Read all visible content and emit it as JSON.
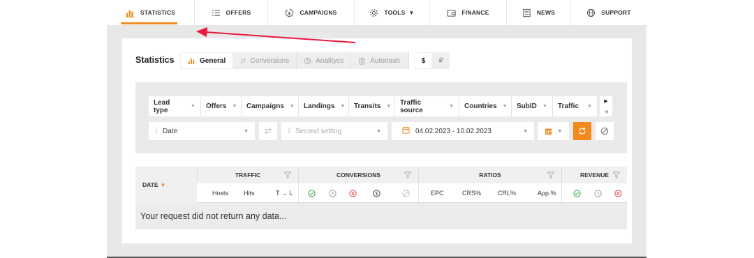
{
  "nav": {
    "items": [
      {
        "label": "STATISTICS",
        "icon": "bar-chart-icon",
        "active": true
      },
      {
        "label": "OFFERS",
        "icon": "list-icon"
      },
      {
        "label": "CAMPAIGNS",
        "icon": "dollar-cycle-icon"
      },
      {
        "label": "TOOLS",
        "icon": "gear-icon"
      },
      {
        "label": "FINANCE",
        "icon": "wallet-icon"
      },
      {
        "label": "NEWS",
        "icon": "newspaper-icon"
      },
      {
        "label": "SUPPORT",
        "icon": "globe-icon"
      }
    ]
  },
  "page": {
    "title": "Statistics"
  },
  "tabs": [
    {
      "label": "General",
      "icon": "bar-chart-icon",
      "active": true
    },
    {
      "label": "Conversions",
      "icon": "sort-arrows-icon"
    },
    {
      "label": "Analitycs",
      "icon": "pie-chart-icon"
    },
    {
      "label": "Autotrash",
      "icon": "trash-icon"
    }
  ],
  "currency": {
    "options": [
      "$",
      "₽"
    ],
    "selected": "$"
  },
  "filters": {
    "chips": [
      "Lead type",
      "Offers",
      "Campaigns",
      "Landings",
      "Transits",
      "Traffic source",
      "Countries",
      "SubID",
      "Traffic"
    ],
    "group_by": "Date",
    "second_setting_placeholder": "Second setting",
    "date_range": "04.02.2023 - 10.02.2023"
  },
  "table": {
    "date_header": "DATE",
    "groups": [
      "TRAFFIC",
      "CONVERSIONS",
      "RATIOS",
      "REVENUE"
    ],
    "traffic_cols": [
      "Hosts",
      "Hits",
      "T → L"
    ],
    "ratio_cols": [
      "EPC",
      "CRS%",
      "CRL%",
      "App.%"
    ],
    "empty_message": "Your request did not return any data..."
  },
  "colors": {
    "accent": "#f28a1e",
    "approved": "#2e9e3a",
    "pending": "#9a9a9a",
    "rejected": "#e04040",
    "annotation_arrow": "#e8193c"
  }
}
